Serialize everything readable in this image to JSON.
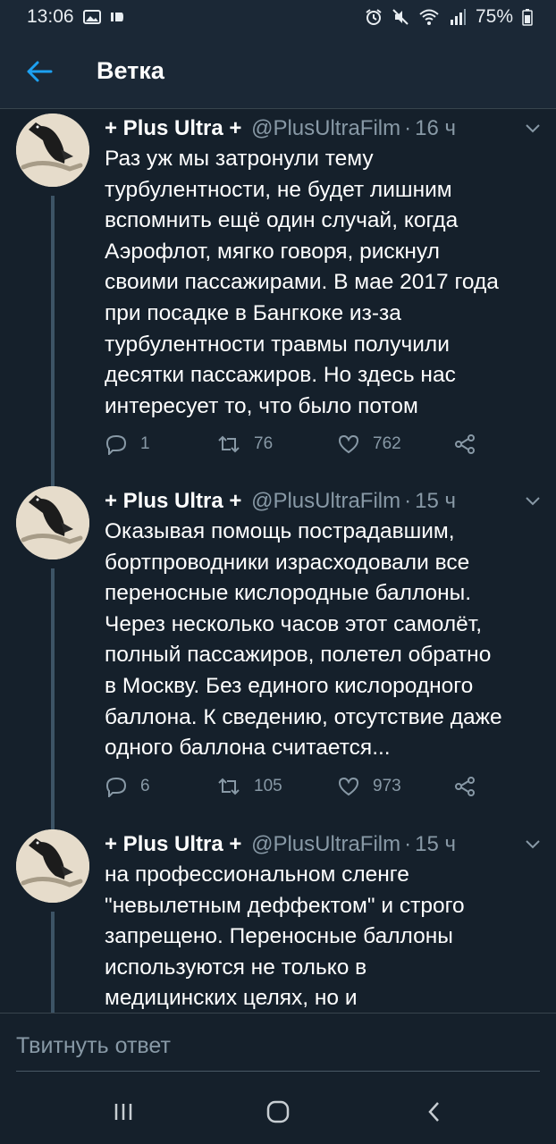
{
  "status_bar": {
    "time": "13:06",
    "battery": "75%"
  },
  "header": {
    "title": "Ветка"
  },
  "tweets": [
    {
      "name": "+ Plus Ultra +",
      "handle": "@PlusUltraFilm",
      "time": "16 ч",
      "text": "Раз уж мы затронули тему\nтурбулентности, не будет лишним\nвспомнить ещё один случай, когда\nАэрофлот, мягко говоря, рискнул\nсвоими пассажирами. В мае 2017 года\nпри посадке в Бангкоке из-за\nтурбулентности травмы получили\nдесятки пассажиров. Но здесь нас\nинтересует то, что было потом",
      "replies": "1",
      "retweets": "76",
      "likes": "762"
    },
    {
      "name": "+ Plus Ultra +",
      "handle": "@PlusUltraFilm",
      "time": "15 ч",
      "text": "Оказывая помощь пострадавшим,\nбортпроводники израсходовали все\nпереносные кислородные баллоны.\nЧерез несколько часов этот самолёт,\nполный пассажиров, полетел обратно\nв Москву. Без единого кислородного\nбаллона. К сведению, отсутствие даже\nодного баллона считается...",
      "replies": "6",
      "retweets": "105",
      "likes": "973"
    },
    {
      "name": "+ Plus Ultra +",
      "handle": "@PlusUltraFilm",
      "time": "15 ч",
      "text": "на профессиональном сленге\n\"невылетным деффектом\" и строго\nзапрещено. Переносные баллоны\nиспользуются не только в\nмедицинских целях, но и"
    }
  ],
  "reply_bar": {
    "placeholder": "Твитнуть ответ"
  },
  "colors": {
    "background": "#15202b",
    "accent": "#1da1f2",
    "secondary_text": "#8899a6"
  }
}
